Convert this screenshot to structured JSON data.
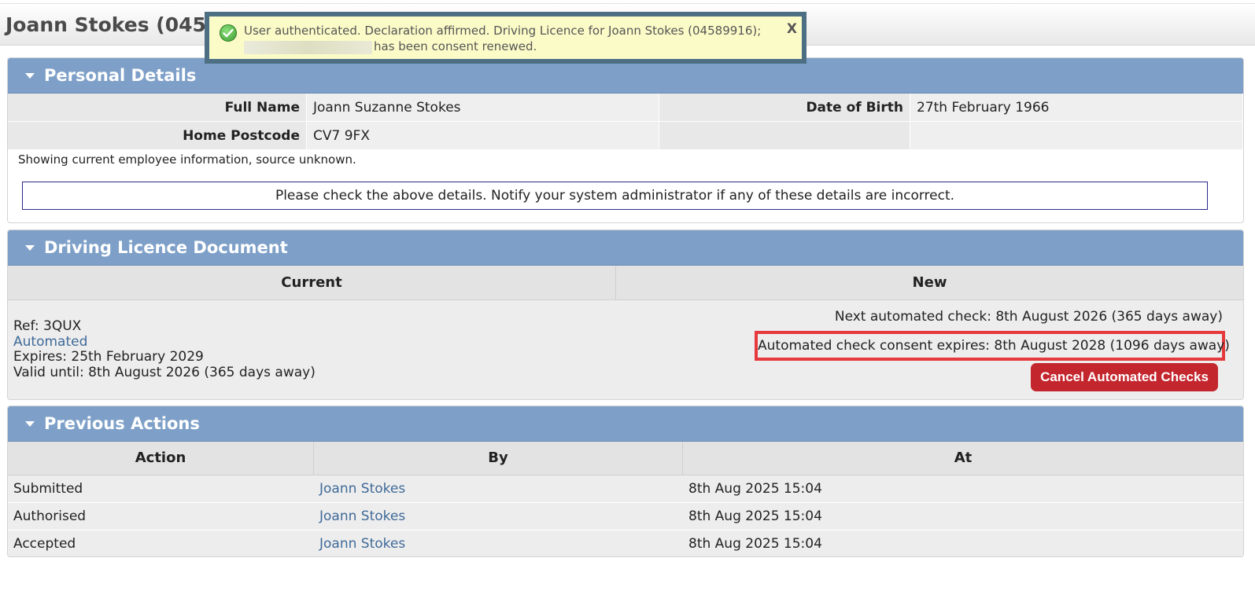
{
  "page": {
    "title": "Joann Stokes (045"
  },
  "notification": {
    "line1": "User authenticated. Declaration affirmed. Driving Licence for Joann Stokes (04589916);",
    "line2": "has been consent renewed.",
    "close_label": "X"
  },
  "personal_details": {
    "title": "Personal Details",
    "full_name_label": "Full Name",
    "full_name": "Joann Suzanne Stokes",
    "dob_label": "Date of Birth",
    "dob": "27th February 1966",
    "postcode_label": "Home Postcode",
    "postcode": "CV7 9FX",
    "source_note": "Showing current employee information, source unknown.",
    "check_notice": "Please check the above details. Notify your system administrator if any of these details are incorrect."
  },
  "driving_licence": {
    "title": "Driving Licence Document",
    "col_current": "Current",
    "col_new": "New",
    "ref": "Ref: 3QUX",
    "automated_link": "Automated",
    "expires": "Expires: 25th February 2029",
    "valid_until": "Valid until: 8th August 2026 (365 days away)",
    "next_check": "Next automated check: 8th August 2026 (365 days away)",
    "consent_expires": "Automated check consent expires: 8th August 2028 (1096 days away)",
    "cancel_button": "Cancel Automated Checks"
  },
  "previous_actions": {
    "title": "Previous Actions",
    "headers": [
      "Action",
      "By",
      "At"
    ],
    "rows": [
      {
        "action": "Submitted",
        "by": "Joann Stokes",
        "at": "8th Aug 2025 15:04"
      },
      {
        "action": "Authorised",
        "by": "Joann Stokes",
        "at": "8th Aug 2025 15:04"
      },
      {
        "action": "Accepted",
        "by": "Joann Stokes",
        "at": "8th Aug 2025 15:04"
      }
    ]
  },
  "colors": {
    "panel_header": "#7ea0c8",
    "notice_bg": "#fbfbc8",
    "notice_border": "#4d6f84",
    "highlight_border": "#e5393d",
    "cancel_button": "#c4262e",
    "link": "#3f6a98"
  }
}
